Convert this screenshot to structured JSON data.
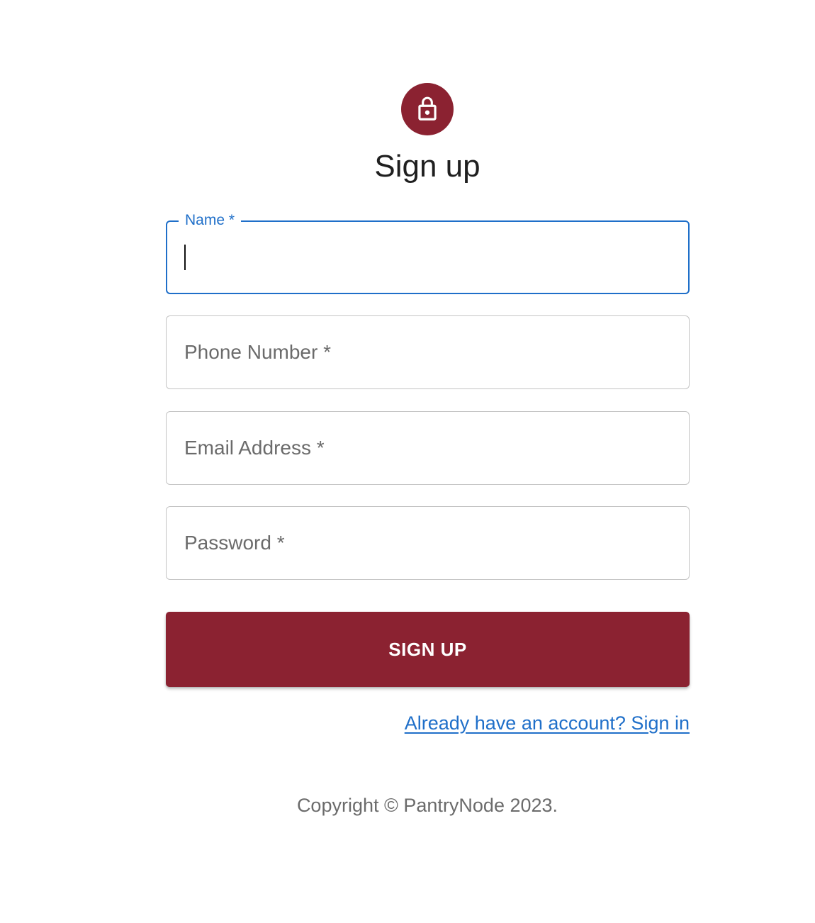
{
  "colors": {
    "brand": "#8b2231",
    "focus": "#1f6fc9",
    "link": "#1f6fc9"
  },
  "header": {
    "icon": "lock-icon",
    "title": "Sign up"
  },
  "form": {
    "name": {
      "label": "Name *",
      "value": ""
    },
    "phone": {
      "label": "Phone Number *",
      "value": ""
    },
    "email": {
      "label": "Email Address *",
      "value": ""
    },
    "password": {
      "label": "Password *",
      "value": ""
    },
    "submit_label": "SIGN UP"
  },
  "signin_link": "Already have an account? Sign in",
  "footer": {
    "copyright": "Copyright © PantryNode 2023."
  }
}
